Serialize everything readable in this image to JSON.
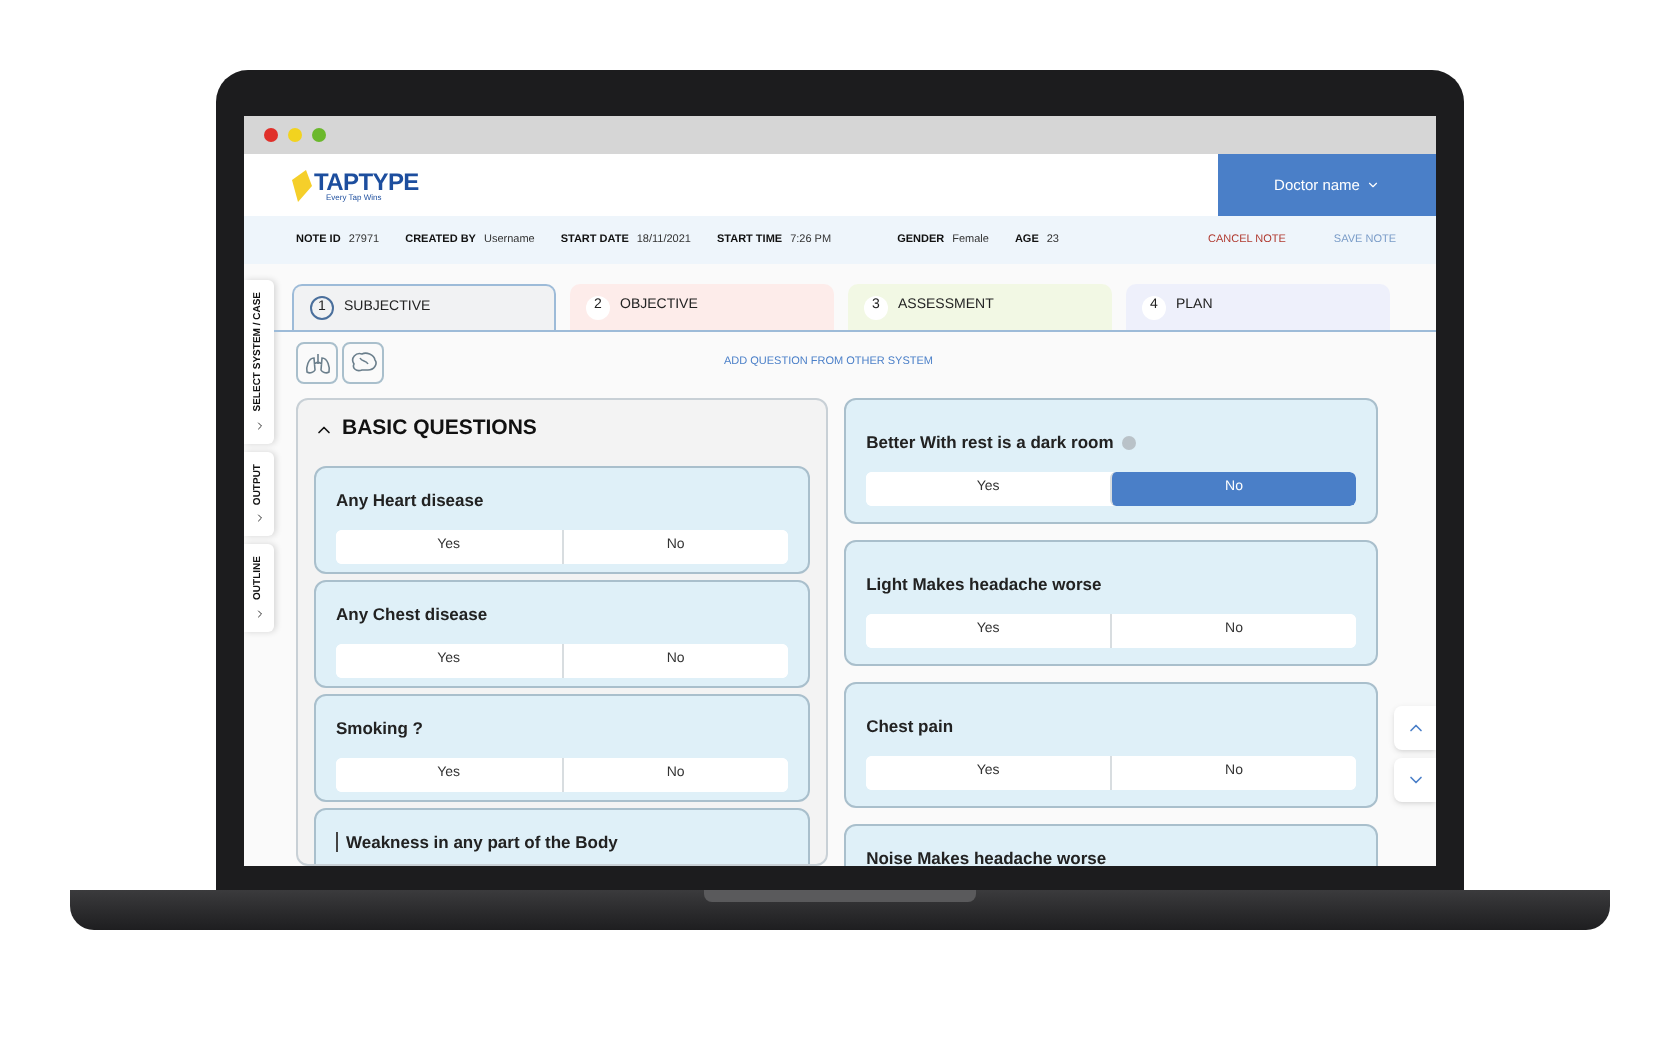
{
  "logo": {
    "name": "TAPTYPE",
    "tagline": "Every Tap Wins"
  },
  "user_menu": {
    "label": "Doctor name"
  },
  "note_info": [
    {
      "label": "NOTE ID",
      "value": "27971"
    },
    {
      "label": "CREATED BY",
      "value": "Username"
    },
    {
      "label": "START DATE",
      "value": "18/11/2021"
    },
    {
      "label": "START TIME",
      "value": "7:26 PM"
    },
    {
      "label": "GENDER",
      "value": "Female"
    },
    {
      "label": "AGE",
      "value": "23"
    }
  ],
  "actions": [
    {
      "label": "CANCEL NOTE",
      "kind": "cancel"
    },
    {
      "label": "SAVE NOTE",
      "kind": "save"
    }
  ],
  "side_tabs": [
    "SELECT SYSTEM / CASE",
    "OUTPUT",
    "OUTLINE"
  ],
  "tabs": [
    {
      "number": "1",
      "label": "SUBJECTIVE",
      "selected": true,
      "color": "#f1f2f3"
    },
    {
      "number": "2",
      "label": "OBJECTIVE",
      "selected": false,
      "color": "#fdecea"
    },
    {
      "number": "3",
      "label": "ASSESSMENT",
      "selected": false,
      "color": "#f2f8e4"
    },
    {
      "number": "4",
      "label": "PLAN",
      "selected": false,
      "color": "#eef0fb"
    }
  ],
  "add_question_link": "ADD QUESTION FROM OTHER SYSTEM",
  "section": {
    "title": "BASIC QUESTIONS",
    "expanded": true,
    "questions": [
      {
        "text": "Any Heart disease",
        "answers": [
          {
            "label": "Yes",
            "selected": false
          },
          {
            "label": "No",
            "selected": false
          }
        ]
      },
      {
        "text": "Any Chest disease",
        "answers": [
          {
            "label": "Yes",
            "selected": false
          },
          {
            "label": "No",
            "selected": false
          }
        ]
      },
      {
        "text": "Smoking ?",
        "answers": [
          {
            "label": "Yes",
            "selected": false
          },
          {
            "label": "No",
            "selected": false
          }
        ]
      },
      {
        "text": "Weakness in any part of the Body"
      }
    ]
  },
  "right_questions": [
    {
      "text": "Better With rest is a dark room",
      "help": true,
      "answers": [
        {
          "label": "Yes",
          "selected": false
        },
        {
          "label": "No",
          "selected": true
        }
      ]
    },
    {
      "text": "Light Makes headache worse",
      "help": false,
      "answers": [
        {
          "label": "Yes",
          "selected": false
        },
        {
          "label": "No",
          "selected": false
        }
      ]
    },
    {
      "text": "Chest pain",
      "help": false,
      "answers": [
        {
          "label": "Yes",
          "selected": false
        },
        {
          "label": "No",
          "selected": false
        }
      ]
    },
    {
      "text": "Noise Makes headache worse",
      "help": false
    }
  ]
}
